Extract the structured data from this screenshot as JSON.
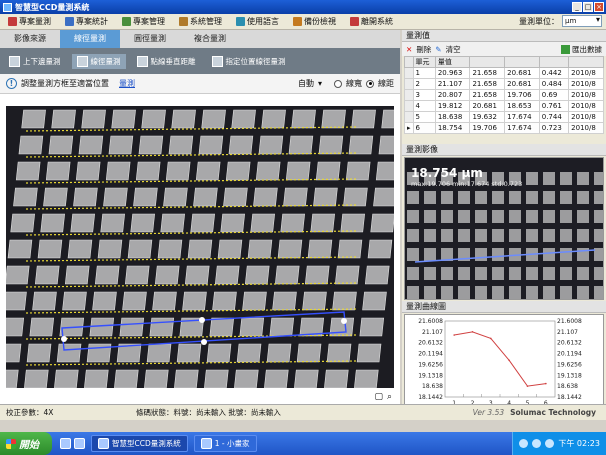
{
  "window": {
    "title": "智慧型CCD量測系統"
  },
  "menu": {
    "items": [
      {
        "label": "專案量測",
        "color": "#c43b3b"
      },
      {
        "label": "專案統計",
        "color": "#3b6fc4"
      },
      {
        "label": "專案管理",
        "color": "#4a8f3c"
      },
      {
        "label": "系統管理",
        "color": "#b07b2a"
      },
      {
        "label": "使用語言",
        "color": "#2a8fb0"
      },
      {
        "label": "備份檢視",
        "color": "#c47a20"
      },
      {
        "label": "離開系統",
        "color": "#c43b3b"
      }
    ],
    "unit_label": "量測單位：",
    "unit_value": "μm"
  },
  "tabs": [
    "影像來源",
    "線徑量測",
    "圓徑量測",
    "複合量測"
  ],
  "subtools": [
    "上下邊量測",
    "線徑量測",
    "點線垂直距離",
    "指定位置線徑量測"
  ],
  "hint": {
    "text": "調整量測方框至適當位置",
    "link": "量測"
  },
  "mode": {
    "label": "自動",
    "opt1": "線寬",
    "opt2": "線距"
  },
  "results": {
    "title": "量測值",
    "delete": "刪除",
    "clear": "清空",
    "export": "匯出數據",
    "headers": [
      "單元",
      "量值",
      "",
      "",
      "",
      ""
    ],
    "rows": [
      [
        "1",
        "20.963",
        "21.658",
        "20.681",
        "0.442",
        "2010/8"
      ],
      [
        "2",
        "21.107",
        "21.658",
        "20.681",
        "0.484",
        "2010/8"
      ],
      [
        "3",
        "20.807",
        "21.658",
        "19.706",
        "0.69",
        "2010/8"
      ],
      [
        "4",
        "19.812",
        "20.681",
        "18.653",
        "0.761",
        "2010/8"
      ],
      [
        "5",
        "18.638",
        "19.632",
        "17.674",
        "0.744",
        "2010/8"
      ],
      [
        "6",
        "18.754",
        "19.706",
        "17.674",
        "0.723",
        "2010/8"
      ]
    ]
  },
  "preview": {
    "title": "量測影像",
    "value": "18.754 μm",
    "stats": "max:19.706 min:17.674 std:0.723"
  },
  "profile": {
    "title": "量測曲線圖"
  },
  "chart_data": {
    "type": "line",
    "x": [
      1,
      2,
      3,
      4,
      5,
      6
    ],
    "values": [
      20.963,
      21.107,
      20.807,
      19.812,
      18.638,
      18.754
    ],
    "ytick_labels": [
      "21.6008",
      "21.107",
      "20.6132",
      "20.1194",
      "19.6256",
      "19.1318",
      "18.638",
      "18.1442"
    ],
    "ylim": [
      18.1442,
      21.6008
    ],
    "xtick_labels": [
      "1",
      "2",
      "3",
      "4",
      "5",
      "6"
    ],
    "color": "#d04040"
  },
  "status": {
    "calib": "校正參數：4X",
    "barcode": "條碼狀態：料號：尚未輸入 批號：尚未輸入",
    "version": "Ver 3.53",
    "company": "Solumac Technology"
  },
  "taskbar": {
    "start": "開始",
    "task1": "智慧型CCD量測系統",
    "task2": "1 - 小畫家",
    "clock": "下午 02:23"
  }
}
